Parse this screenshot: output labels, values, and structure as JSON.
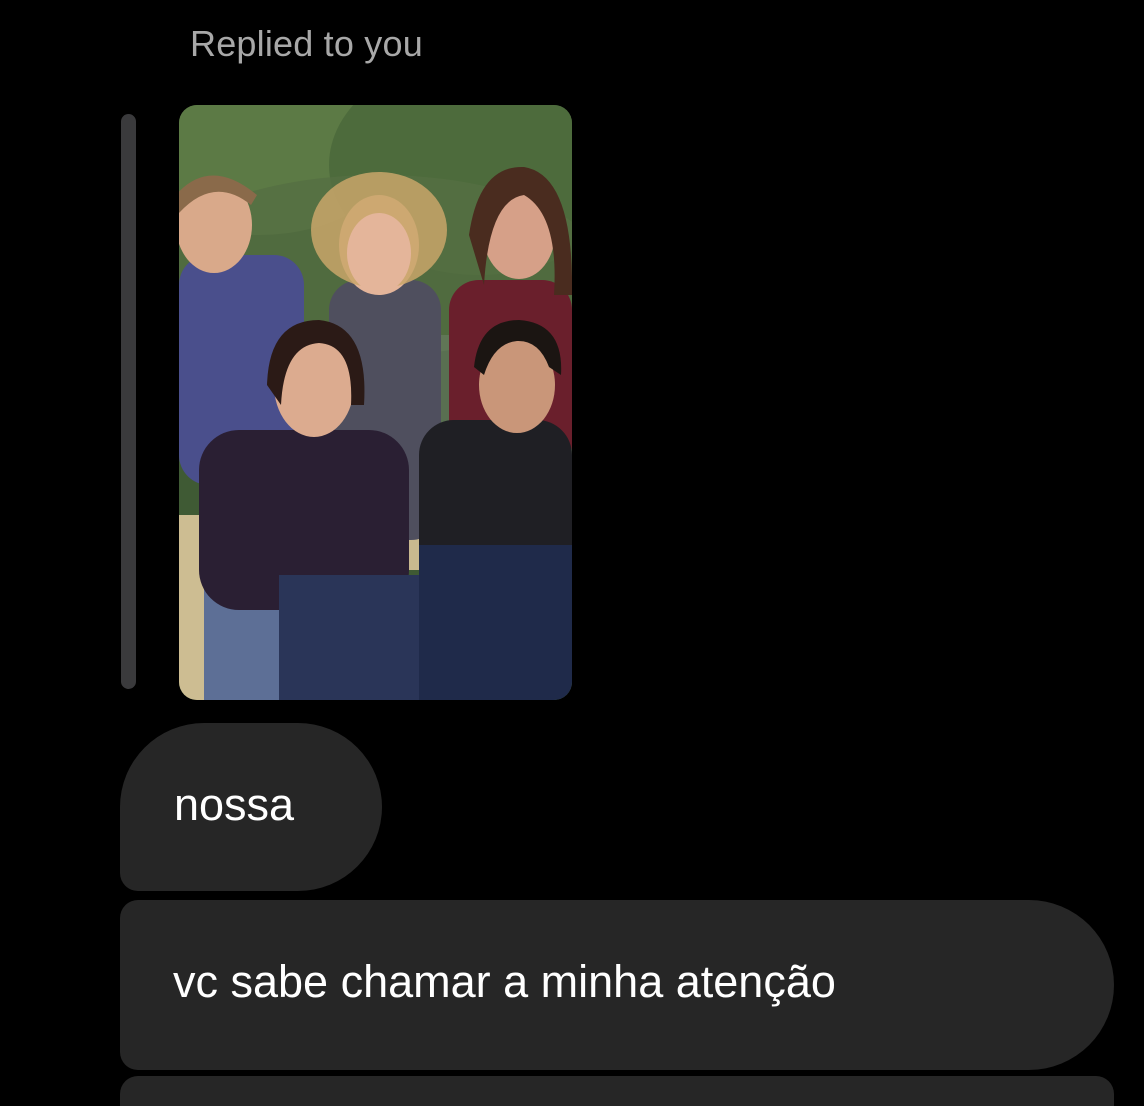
{
  "thread": {
    "reply_label": "Replied to you",
    "replied_media": {
      "kind": "photo",
      "icon": "group-photo-icon"
    },
    "messages": [
      {
        "text": "nossa"
      },
      {
        "text": "vc sabe chamar a minha atenção"
      }
    ]
  },
  "colors": {
    "background": "#000000",
    "bubble": "#262626",
    "reply_label": "#a8a8a8",
    "reply_bar": "#3a3a3c"
  }
}
